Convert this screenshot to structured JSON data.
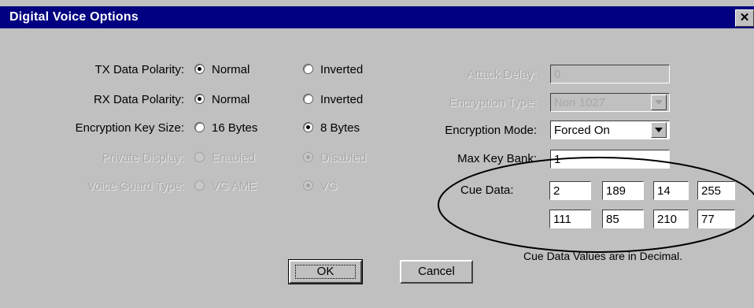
{
  "window": {
    "title": "Digital Voice Options",
    "close_symbol": "✕"
  },
  "left": {
    "tx_label": "TX Data Polarity:",
    "tx_opt1": "Normal",
    "tx_opt2": "Inverted",
    "rx_label": "RX Data Polarity:",
    "rx_opt1": "Normal",
    "rx_opt2": "Inverted",
    "key_label": "Encryption Key Size:",
    "key_opt1": "16 Bytes",
    "key_opt2": "8 Bytes",
    "private_label": "Private Display:",
    "private_opt1": "Enabled",
    "private_opt2": "Disabled",
    "vg_label": "Voice Guard Type:",
    "vg_opt1": "VG AME",
    "vg_opt2": "VG"
  },
  "right": {
    "attack_label": "Attack Delay:",
    "attack_value": "0",
    "enc_type_label": "Encryption Type:",
    "enc_type_value": "Non 1027",
    "enc_mode_label": "Encryption Mode:",
    "enc_mode_value": "Forced On",
    "max_key_label": "Max Key Bank:",
    "max_key_value": "1",
    "cue_label": "Cue Data:",
    "cue_values": [
      "2",
      "189",
      "14",
      "255",
      "111",
      "85",
      "210",
      "77"
    ],
    "cue_note": "Cue Data Values are in Decimal."
  },
  "buttons": {
    "ok": "OK",
    "cancel": "Cancel"
  }
}
